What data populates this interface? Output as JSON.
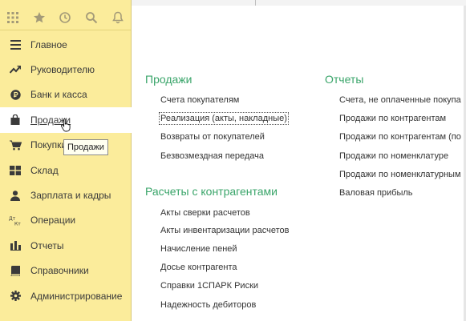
{
  "sidebar": {
    "items": [
      {
        "label": "Главное",
        "icon": "menu-lines-icon"
      },
      {
        "label": "Руководителю",
        "icon": "trend-arrow-icon"
      },
      {
        "label": "Банк и касса",
        "icon": "coin-icon"
      },
      {
        "label": "Продажи",
        "icon": "shopping-bag-icon",
        "active": true
      },
      {
        "label": "Покупки",
        "icon": "shopping-cart-icon"
      },
      {
        "label": "Склад",
        "icon": "warehouse-icon"
      },
      {
        "label": "Зарплата и кадры",
        "icon": "person-icon"
      },
      {
        "label": "Операции",
        "icon": "dt-kt-icon"
      },
      {
        "label": "Отчеты",
        "icon": "bar-chart-icon"
      },
      {
        "label": "Справочники",
        "icon": "book-icon"
      },
      {
        "label": "Администрирование",
        "icon": "gear-icon"
      }
    ],
    "tooltip": "Продажи"
  },
  "sales": {
    "title": "Продажи",
    "links": [
      "Счета покупателям",
      "Реализация (акты, накладные)",
      "Возвраты от покупателей",
      "Безвозмездная передача"
    ]
  },
  "settlements": {
    "title": "Расчеты с контрагентами",
    "links": [
      "Акты сверки расчетов",
      "Акты инвентаризации расчетов",
      "Начисление пеней",
      "Досье контрагента",
      "Справки 1СПАРК Риски",
      "Надежность дебиторов"
    ]
  },
  "reports": {
    "title": "Отчеты",
    "links": [
      "Счета, не оплаченные покупа",
      "Продажи по контрагентам",
      "Продажи по контрагентам (по",
      "Продажи по номенклатуре",
      "Продажи по номенклатурным",
      "Валовая прибыль"
    ]
  }
}
